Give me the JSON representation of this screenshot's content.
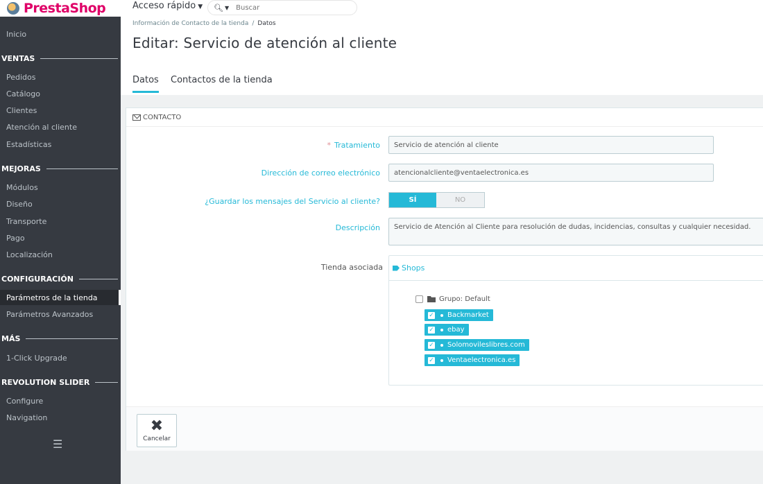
{
  "brand": {
    "part1": "Presta",
    "part2": "Shop"
  },
  "topbar": {
    "quick_access": "Acceso rápido",
    "search_placeholder": "Buscar"
  },
  "sidebar": {
    "home": "Inicio",
    "sections": [
      {
        "title": "VENTAS",
        "items": [
          "Pedidos",
          "Catálogo",
          "Clientes",
          "Atención al cliente",
          "Estadísticas"
        ]
      },
      {
        "title": "MEJORAS",
        "items": [
          "Módulos",
          "Diseño",
          "Transporte",
          "Pago",
          "Localización"
        ]
      },
      {
        "title": "CONFIGURACIÓN",
        "items": [
          "Parámetros de la tienda",
          "Parámetros Avanzados"
        ]
      },
      {
        "title": "MÁS",
        "items": [
          "1-Click Upgrade"
        ]
      },
      {
        "title": "REVOLUTION SLIDER",
        "items": [
          "Configure",
          "Navigation"
        ]
      }
    ],
    "active_item": "Parámetros de la tienda"
  },
  "header": {
    "breadcrumb": [
      "Información de Contacto de la tienda",
      "Datos"
    ],
    "title": "Editar: Servicio de atención al cliente",
    "tabs": [
      "Datos",
      "Contactos de la tienda"
    ],
    "active_tab": "Datos"
  },
  "panel": {
    "heading": "CONTACTO",
    "fields": {
      "title_label": "Tratamiento",
      "title_value": "Servicio de atención al cliente",
      "email_label": "Dirección de correo electrónico",
      "email_value": "atencionalcliente@ventaelectronica.es",
      "save_messages_label": "¿Guardar los mensajes del Servicio al cliente?",
      "switch_on": "SÍ",
      "switch_off": "NO",
      "switch_value": "SÍ",
      "description_label": "Descripción",
      "description_value": "Servicio de Atención al Cliente para resolución de dudas, incidencias, consultas y cualquier necesidad.",
      "shop_label": "Tienda asociada"
    },
    "shops": {
      "heading": "Shops",
      "group": "Grupo: Default",
      "items": [
        "Backmarket",
        "ebay",
        "Solomovileslibres.com",
        "Ventaelectronica.es"
      ]
    },
    "footer": {
      "cancel": "Cancelar"
    }
  },
  "colors": {
    "accent": "#25b9d7",
    "sidebar": "#363a41",
    "brand": "#df0067"
  }
}
